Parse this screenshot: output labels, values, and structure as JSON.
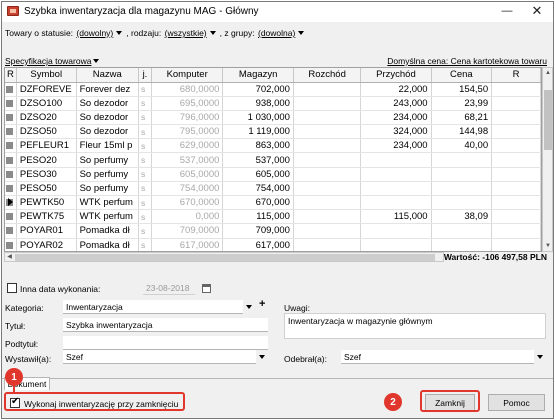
{
  "window": {
    "title": "Szybka inwentaryzacja dla magazynu MAG - Główny",
    "minimize": "—",
    "close": "✕"
  },
  "filters": {
    "prefix": "Towary o statusie:",
    "status": "(dowolny)",
    "rodzaj_prefix": ", rodzaju:",
    "rodzaj": "(wszystkie)",
    "grupa_prefix": ", z grupy:",
    "grupa": "(dowolna)"
  },
  "spec_label": "Specyfikacja towarowa",
  "price_label": "Domyślna cena: Cena kartotekowa towaru",
  "grid": {
    "columns": [
      "R",
      "Symbol",
      "Nazwa",
      "j.",
      "Komputer",
      "Magazyn",
      "Rozchód",
      "Przychód",
      "Cena",
      "R"
    ],
    "rows": [
      {
        "symbol": "DZFOREVE",
        "nazwa": "Forever dez",
        "j": "s",
        "komputer": "680,0000",
        "magazyn": "702,000",
        "rozchod": "",
        "przychod": "22,000",
        "cena": "154,50"
      },
      {
        "symbol": "DZSO100",
        "nazwa": "So dezodor",
        "j": "s",
        "komputer": "695,0000",
        "magazyn": "938,000",
        "rozchod": "",
        "przychod": "243,000",
        "cena": "23,99"
      },
      {
        "symbol": "DZSO20",
        "nazwa": "So dezodor",
        "j": "s",
        "komputer": "796,0000",
        "magazyn": "1 030,000",
        "rozchod": "",
        "przychod": "234,000",
        "cena": "68,21"
      },
      {
        "symbol": "DZSO50",
        "nazwa": "So dezodor",
        "j": "s",
        "komputer": "795,0000",
        "magazyn": "1 119,000",
        "rozchod": "",
        "przychod": "324,000",
        "cena": "144,98"
      },
      {
        "symbol": "PEFLEUR1",
        "nazwa": "Fleur 15ml p",
        "j": "s",
        "komputer": "629,0000",
        "magazyn": "863,000",
        "rozchod": "",
        "przychod": "234,000",
        "cena": "40,00"
      },
      {
        "symbol": "PESO20",
        "nazwa": "So perfumy",
        "j": "s",
        "komputer": "537,0000",
        "magazyn": "537,000",
        "rozchod": "",
        "przychod": "",
        "cena": ""
      },
      {
        "symbol": "PESO30",
        "nazwa": "So perfumy",
        "j": "s",
        "komputer": "605,0000",
        "magazyn": "605,000",
        "rozchod": "",
        "przychod": "",
        "cena": ""
      },
      {
        "symbol": "PESO50",
        "nazwa": "So perfumy",
        "j": "s",
        "komputer": "754,0000",
        "magazyn": "754,000",
        "rozchod": "",
        "przychod": "",
        "cena": ""
      },
      {
        "symbol": "PEWTK50",
        "nazwa": "WTK perfum",
        "j": "s",
        "komputer": "670,0000",
        "magazyn": "670,000",
        "rozchod": "",
        "przychod": "",
        "cena": ""
      },
      {
        "symbol": "PEWTK75",
        "nazwa": "WTK perfum",
        "j": "s",
        "komputer": "0,000",
        "magazyn": "115,000",
        "rozchod": "",
        "przychod": "115,000",
        "cena": "38,09"
      },
      {
        "symbol": "POYAR01",
        "nazwa": "Pomadka dł",
        "j": "s",
        "komputer": "709,0000",
        "magazyn": "709,000",
        "rozchod": "",
        "przychod": "",
        "cena": ""
      },
      {
        "symbol": "POYAR02",
        "nazwa": "Pomadka dł",
        "j": "s",
        "komputer": "617,0000",
        "magazyn": "617,000",
        "rozchod": "",
        "przychod": "",
        "cena": ""
      }
    ]
  },
  "wartosc": "Wartość: -106 497,58 PLN",
  "form": {
    "inna_data_label": "Inna data wykonania:",
    "inna_data_value": "23-08-2018",
    "kategoria_label": "Kategoria:",
    "kategoria_value": "Inwentaryzacja",
    "plus": "+",
    "tytul_label": "Tytuł:",
    "tytul_value": "Szybka inwentaryzacja",
    "podtytul_label": "Podtytuł:",
    "podtytul_value": "",
    "wystawil_label": "Wystawił(a):",
    "wystawil_value": "Szef",
    "uwagi_label": "Uwagi:",
    "uwagi_value": "Inwentaryzacja w magazynie głównym",
    "odebral_label": "Odebrał(a):",
    "odebral_value": "Szef"
  },
  "tab_label": "Dokument",
  "wykonaj_label": "Wykonaj inwentaryzację przy zamknięciu",
  "buttons": {
    "zamknij": "Zamknij",
    "pomoc": "Pomoc"
  },
  "annotations": {
    "badge1": "1",
    "badge2": "2",
    "color": "#e0362c"
  },
  "icons": {
    "app": "document-icon",
    "spec_arrow": "chevron-down-icon",
    "row_pointer": "triangle-right-icon"
  }
}
